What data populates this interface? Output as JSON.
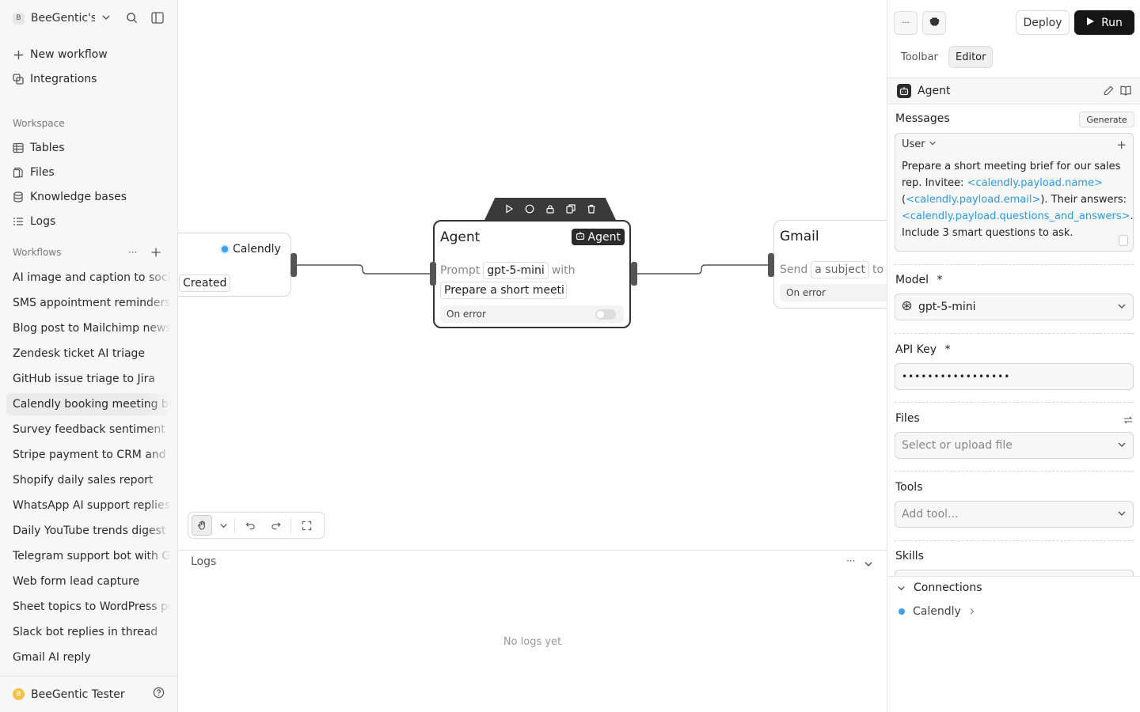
{
  "sidebar": {
    "workspace_badge": "B",
    "workspace_name": "BeeGentic's",
    "top_items": [
      {
        "label": "New workflow",
        "icon": "plus-icon"
      },
      {
        "label": "Integrations",
        "icon": "integrations-icon"
      }
    ],
    "workspace_heading": "Workspace",
    "workspace_items": [
      {
        "label": "Tables",
        "icon": "table-icon"
      },
      {
        "label": "Files",
        "icon": "files-icon"
      },
      {
        "label": "Knowledge bases",
        "icon": "database-icon"
      },
      {
        "label": "Logs",
        "icon": "list-icon"
      }
    ],
    "workflows_heading": "Workflows",
    "workflows": [
      "AI image and caption to social",
      "SMS appointment reminders",
      "Blog post to Mailchimp newsletter",
      "Zendesk ticket AI triage",
      "GitHub issue triage to Jira",
      "Calendly booking meeting brief",
      "Survey feedback sentiment",
      "Stripe payment to CRM and",
      "Shopify daily sales report",
      "WhatsApp AI support replies",
      "Daily YouTube trends digest",
      "Telegram support bot with GPT",
      "Web form lead capture",
      "Sheet topics to WordPress posts",
      "Slack bot replies in thread",
      "Gmail AI reply"
    ],
    "active_workflow_index": 5,
    "user_initial": "B",
    "user_name": "BeeGentic Tester"
  },
  "canvas": {
    "calendly_node": {
      "title": "Calendly",
      "chip": "Created"
    },
    "agent_node": {
      "title": "Agent",
      "badge": "Agent",
      "prompt_label": "Prompt",
      "model_chip": "gpt-5-mini",
      "with_label": "with",
      "prompt_chip": "Prepare a short meeti",
      "on_error": "On error"
    },
    "gmail_node": {
      "title": "Gmail",
      "send_label": "Send",
      "subject_chip": "a subject",
      "to_label": "to",
      "on_error": "On error"
    }
  },
  "logs": {
    "title": "Logs",
    "empty_text": "No logs yet"
  },
  "panel": {
    "more_label": "···",
    "deploy_label": "Deploy",
    "run_label": "Run",
    "tabs": [
      "Toolbar",
      "Editor"
    ],
    "active_tab": 1,
    "block_title": "Agent",
    "messages_label": "Messages",
    "generate_label": "Generate",
    "message": {
      "role": "User",
      "text_1": "Prepare a short meeting brief for our sales rep. Invitee: ",
      "ref_1": "<calendly.payload.name>",
      "text_2": " (",
      "ref_2": "<calendly.payload.email>",
      "text_3": "). Their answers: ",
      "ref_3": "<calendly.payload.questions_and_answers>",
      "text_4": ". Include 3 smart questions to ask."
    },
    "model_label": "Model",
    "model_value": "gpt-5-mini",
    "api_key_label": "API Key",
    "api_key_value": "•••••••••••••••••",
    "required_mark": "*",
    "files_label": "Files",
    "files_placeholder": "Select or upload file",
    "tools_label": "Tools",
    "tools_placeholder": "Add tool...",
    "skills_label": "Skills",
    "connections_label": "Connections",
    "connection_item": "Calendly"
  }
}
